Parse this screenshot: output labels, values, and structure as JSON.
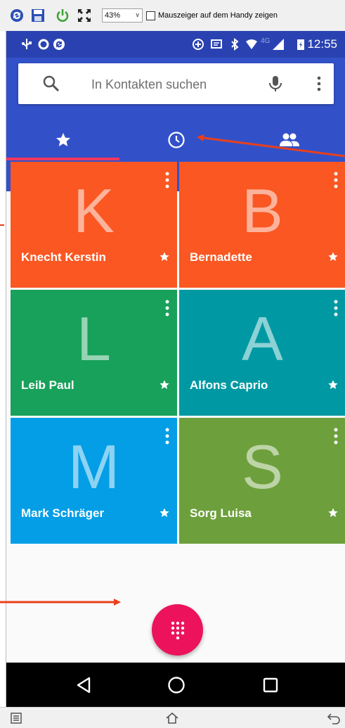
{
  "host": {
    "zoom": "43%",
    "pointer_checkbox_label": "Mauszeiger auf dem Handy zeigen",
    "pointer_checked": false
  },
  "status_bar": {
    "time": "12:55",
    "network": "4G",
    "background": "#2a42b1"
  },
  "search": {
    "placeholder": "In Kontakten suchen"
  },
  "tabs": [
    {
      "name": "Favoriten",
      "icon": "star-icon",
      "active": true
    },
    {
      "name": "Zuletzt",
      "icon": "clock-icon",
      "active": false
    },
    {
      "name": "Kontakte",
      "icon": "people-icon",
      "active": false
    }
  ],
  "contacts": [
    {
      "letter": "K",
      "name": "Knecht Kerstin",
      "color": "#fa5722"
    },
    {
      "letter": "B",
      "name": "Bernadette",
      "color": "#fa5722"
    },
    {
      "letter": "L",
      "name": "Leib Paul",
      "color": "#18a15a"
    },
    {
      "letter": "A",
      "name": "Alfons Caprio",
      "color": "#0099a3"
    },
    {
      "letter": "M",
      "name": "Mark Schräger",
      "color": "#049ee6"
    },
    {
      "letter": "S",
      "name": "Sorg Luisa",
      "color": "#6da03c"
    }
  ],
  "colors": {
    "app_bar": "#3251c9",
    "tab_indicator": "#f2365f",
    "fab": "#ec135c",
    "annotation_arrow": "#e8401c"
  },
  "icons": {
    "fab": "dialpad-icon",
    "nav": [
      "back-icon",
      "home-icon",
      "recents-icon"
    ]
  }
}
